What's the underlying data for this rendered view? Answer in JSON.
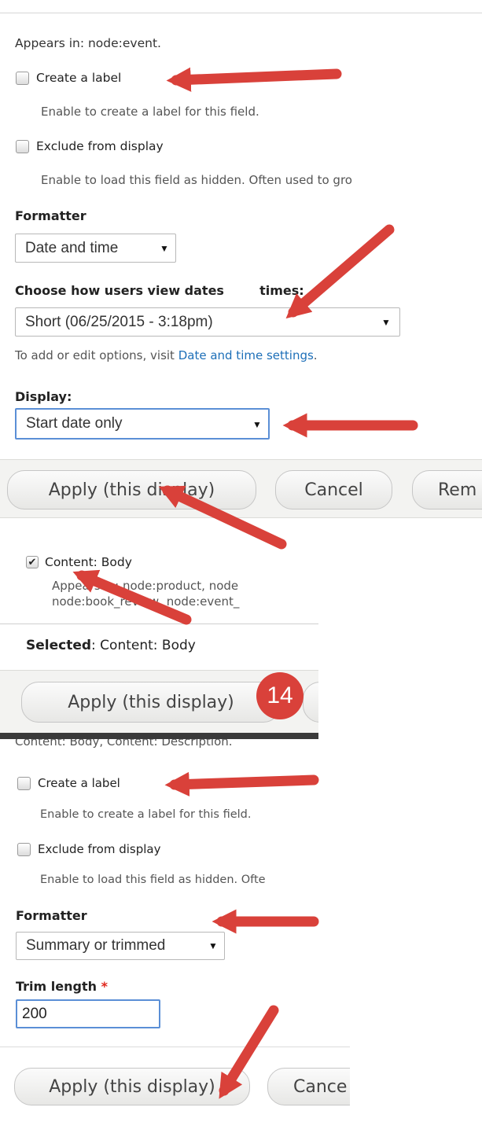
{
  "panel1": {
    "appears_in": "Appears in: node:event.",
    "create_label": {
      "label": "Create a label",
      "checked": false,
      "desc": "Enable to create a label for this field."
    },
    "exclude": {
      "label": "Exclude from display",
      "checked": false,
      "desc": "Enable to load this field as hidden. Often used to gro"
    },
    "formatter": {
      "label": "Formatter",
      "value": "Date and time",
      "caret": "▼"
    },
    "choose": {
      "label_before": "Choose how users view dates ",
      "label_after": " times:",
      "value": "Short (06/25/2015 - 3:18pm)",
      "caret": "▼"
    },
    "edit_hint": {
      "text": "To add or edit options, visit ",
      "link": "Date and time settings",
      "suffix": "."
    },
    "display": {
      "label": "Display:",
      "value": "Start date only",
      "caret": "▼"
    }
  },
  "buttons1": {
    "apply": "Apply (this display)",
    "cancel": "Cancel",
    "remove": "Rem"
  },
  "panel2": {
    "content_body": {
      "label": "Content: Body",
      "checked": true,
      "checkmark": "✔"
    },
    "appears_line1": "Appears in: node:product, node",
    "appears_line2": "node:book_review, node:event_",
    "selected_key": "Selected",
    "selected_value": ": Content: Body"
  },
  "buttons2": {
    "apply": "Apply (this display)",
    "step_badge": "14"
  },
  "panel3": {
    "cut_text": "Content: Body, Content: Description.",
    "create_label": {
      "label": "Create a label",
      "checked": false,
      "desc": "Enable to create a label for this field."
    },
    "exclude": {
      "label": "Exclude from display",
      "checked": false,
      "desc": "Enable to load this field as hidden. Ofte"
    },
    "formatter": {
      "label": "Formatter",
      "value": "Summary or trimmed",
      "caret": "▼"
    },
    "trim": {
      "label": "Trim length",
      "required_mark": "*",
      "value": "200"
    }
  },
  "buttons3": {
    "apply": "Apply (this display)",
    "cancel": "Cance"
  },
  "colors": {
    "arrow": "#d9413a",
    "badge": "#d9413a",
    "link": "#1d6fb8",
    "focus": "#5b8fd6"
  }
}
